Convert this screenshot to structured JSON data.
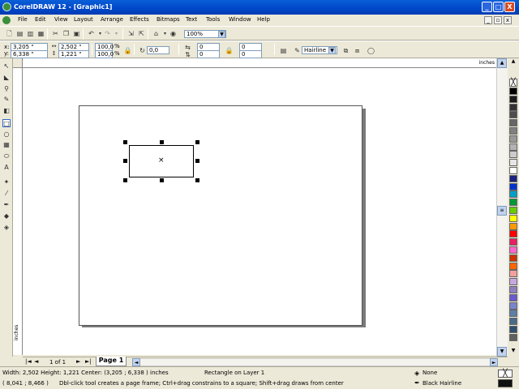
{
  "window": {
    "title": "CorelDRAW 12 - [Graphic1]",
    "buttons": {
      "minimize": "_",
      "maximize": "□",
      "close": "X"
    },
    "doc_buttons": {
      "minimize": "_",
      "restore": "▫",
      "close": "x"
    }
  },
  "menu": {
    "items": [
      "File",
      "Edit",
      "View",
      "Layout",
      "Arrange",
      "Effects",
      "Bitmaps",
      "Text",
      "Tools",
      "Window",
      "Help"
    ]
  },
  "standard_toolbar": {
    "zoom_value": "100%"
  },
  "property_bar": {
    "x_label": "x:",
    "y_label": "y:",
    "x_value": "3,205 \"",
    "y_value": "6,338 \"",
    "width_value": "2,502 \"",
    "height_value": "1,221 \"",
    "scale_w": "100,0",
    "scale_h": "100,0",
    "scale_unit": "%",
    "rotation": "0,0",
    "corner_tl": "0",
    "corner_bl": "0",
    "corner_tr": "0",
    "corner_br": "0",
    "outline_width": "Hairline"
  },
  "rulers": {
    "units": "inches"
  },
  "page_nav": {
    "first": "|◄",
    "prev": "◄",
    "counter": "1 of 1",
    "next": "►",
    "last": "►|",
    "tab": "Page 1"
  },
  "status": {
    "dimensions": "Width: 2,502  Height: 1,221  Center: (3,205 ; 6,338 )  inches",
    "object": "Rectangle on Layer 1",
    "cursor": "( 8,041 ; 8,466 )",
    "hint": "Dbl-click tool creates a page frame; Ctrl+drag constrains to a square; Shift+drag draws from center",
    "fill_label": "None",
    "outline_label": "Black  Hairline"
  },
  "palette_colors": [
    "#000000",
    "#1a1a1a",
    "#333333",
    "#4d4d4d",
    "#666666",
    "#808080",
    "#999999",
    "#b3b3b3",
    "#cccccc",
    "#e6e6e6",
    "#ffffff",
    "#1a237e",
    "#0033cc",
    "#00a0c6",
    "#009933",
    "#66cc00",
    "#ffff00",
    "#ff9900",
    "#ff0000",
    "#e91e63",
    "#ff66cc",
    "#cc3300",
    "#ff6600",
    "#f4a0a0",
    "#c8a8e0",
    "#8f7fc0",
    "#6a5acd",
    "#7986cb",
    "#5c7fa8",
    "#4a6a8a",
    "#2f4f6f",
    "#606060"
  ]
}
